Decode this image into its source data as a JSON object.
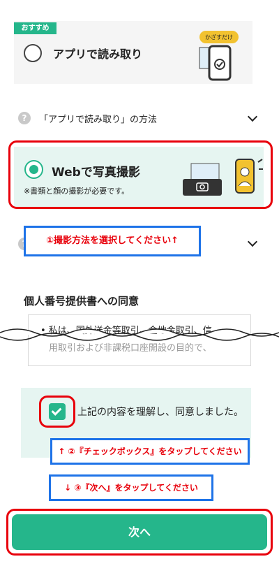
{
  "options": [
    {
      "badge": "おすすめ",
      "label": "アプリで読み取り",
      "selected": false,
      "illustration_tag": "かざすだけ"
    },
    {
      "label": "Webで写真撮影",
      "note": "※書類と顔の撮影が必要です。",
      "selected": true
    }
  ],
  "methods": [
    {
      "label": "「アプリで読み取り」の方法",
      "icon": "question-icon"
    },
    {
      "icon": "question-icon"
    }
  ],
  "instructions": {
    "step1": "①撮影方法を選択してください↑",
    "step2": "↑ ②『チェックボックス』をタップしてください",
    "step3": "↓ ③『次へ』をタップしてください"
  },
  "consent": {
    "title": "個人番号提供書への同意",
    "text": "•  私は、国外送金等取引、金地金取引、信",
    "text_partial": "用取引および非課税口座開設の目的で、",
    "agree_label": "上記の内容を理解し、同意しました。",
    "checked": true
  },
  "next_button": "次へ",
  "colors": {
    "accent": "#25b68b",
    "highlight_red": "#e8000b",
    "highlight_blue": "#1e73e8"
  }
}
